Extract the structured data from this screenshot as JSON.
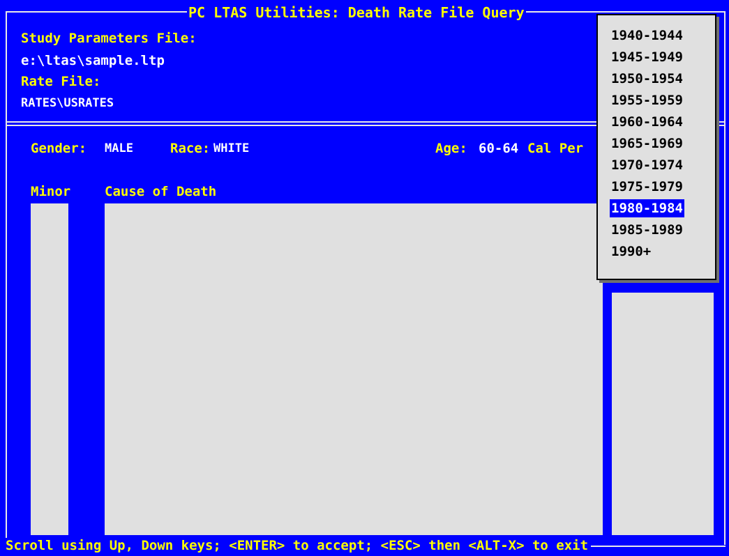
{
  "window": {
    "title": "PC LTAS Utilities: Death Rate File Query"
  },
  "header": {
    "study_params_label": "Study Parameters File:",
    "study_params_value": "e:\\ltas\\sample.ltp",
    "rate_file_label": "Rate File:",
    "rate_file_value": "RATES\\USRATES"
  },
  "filters": {
    "gender_label": "Gender:",
    "gender_value": "MALE",
    "race_label": "Race:",
    "race_value": "WHITE",
    "age_label": "Age:",
    "age_value": "60-64",
    "calper_label": "Cal Per"
  },
  "columns": {
    "minor": "Minor",
    "cause": "Cause of Death"
  },
  "dropdown": {
    "items": [
      "1940-1944",
      "1945-1949",
      "1950-1954",
      "1955-1959",
      "1960-1964",
      "1965-1969",
      "1970-1974",
      "1975-1979",
      "1980-1984",
      "1985-1989",
      "1990+"
    ],
    "selected": "1980-1984"
  },
  "status_bar": "Scroll using Up, Down keys; <ENTER> to accept; <ESC> then <ALT-X> to exit",
  "colors": {
    "background": "#0000FF",
    "label": "#FFFF00",
    "value": "#FFFFFF",
    "panel": "#E0E0E0"
  }
}
